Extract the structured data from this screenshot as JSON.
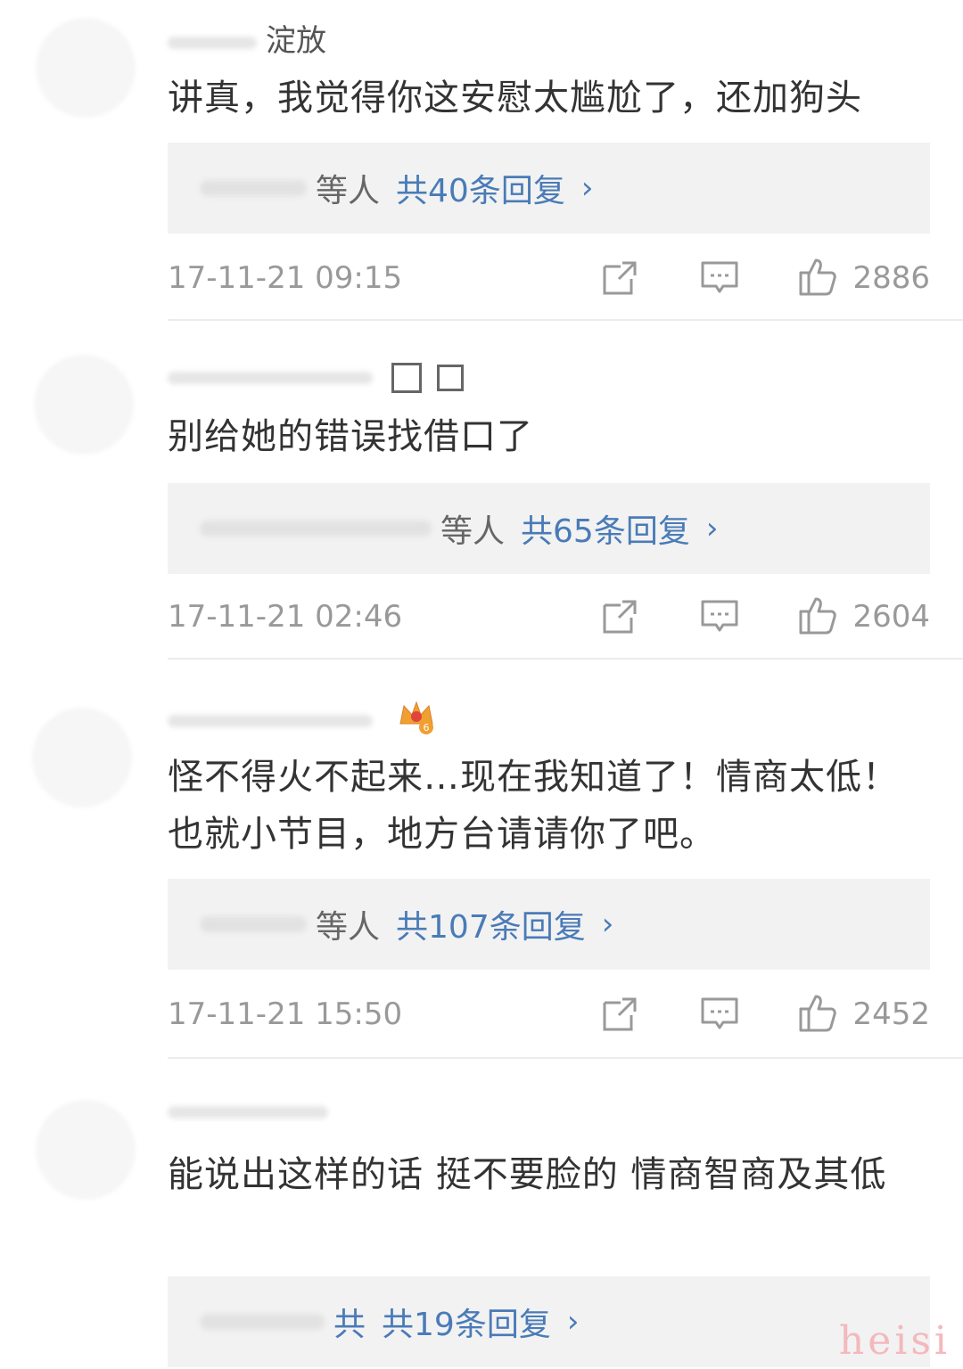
{
  "comments": [
    {
      "name": "淀放",
      "text": "讲真，我觉得你这安慰太尴尬了，还加狗头",
      "reply_who": "等人",
      "reply_count": "共40条回复",
      "reply_arrow": "›",
      "time": "17-11-21 09:15",
      "likes": "2886"
    },
    {
      "name": "",
      "text": "别给她的错误找借口了",
      "reply_who": "等人",
      "reply_count": "共65条回复",
      "reply_arrow": "›",
      "time": "17-11-21 02:46",
      "likes": "2604"
    },
    {
      "name": "",
      "text": "怪不得火不起来…现在我知道了！情商太低！也就小节目，地方台请请你了吧。",
      "reply_who": "等人",
      "reply_count": "共107条回复",
      "reply_arrow": "›",
      "time": "17-11-21 15:50",
      "likes": "2452",
      "badge": "6"
    },
    {
      "name": "",
      "text": "能说出这样的话 挺不要脸的 情商智商及其低",
      "reply_who": "共",
      "reply_count": "共19条回复",
      "reply_arrow": "›"
    }
  ],
  "icons": {
    "repost": "repost-icon",
    "comment": "comment-icon",
    "like": "thumbs-up-icon"
  },
  "colors": {
    "link": "#4a7bb7",
    "meta": "#999999",
    "reply_bg": "#f2f2f2"
  },
  "watermark": "heisi"
}
